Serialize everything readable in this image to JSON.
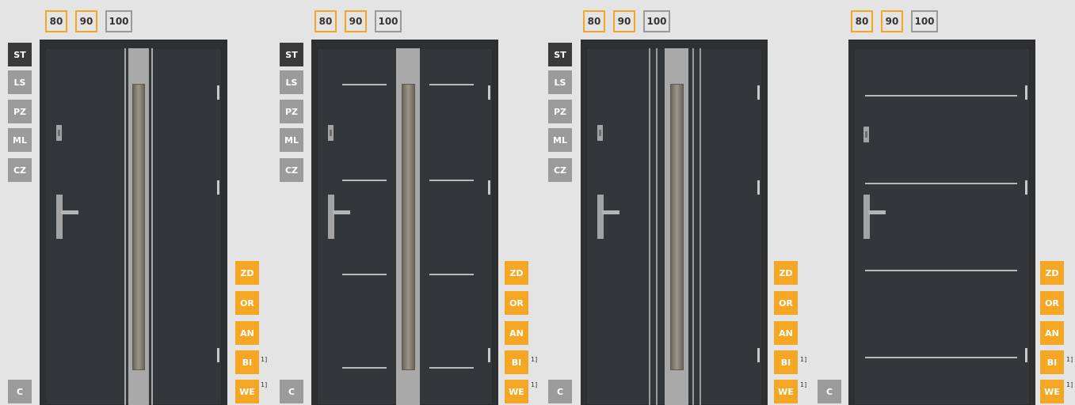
{
  "widths": {
    "available": [
      "80",
      "90"
    ],
    "unavailable": [
      "100"
    ],
    "accent_color": "#f5a623",
    "disabled_color": "#9a9a9a"
  },
  "colors_left": [
    "ST",
    "LS",
    "PZ",
    "ML",
    "CZ"
  ],
  "colors_left_bottom": "C",
  "colors_right": [
    "ZD",
    "OR",
    "AN",
    "BI",
    "WE"
  ],
  "footnote_mark": "1]",
  "door_color": "#34373a"
}
